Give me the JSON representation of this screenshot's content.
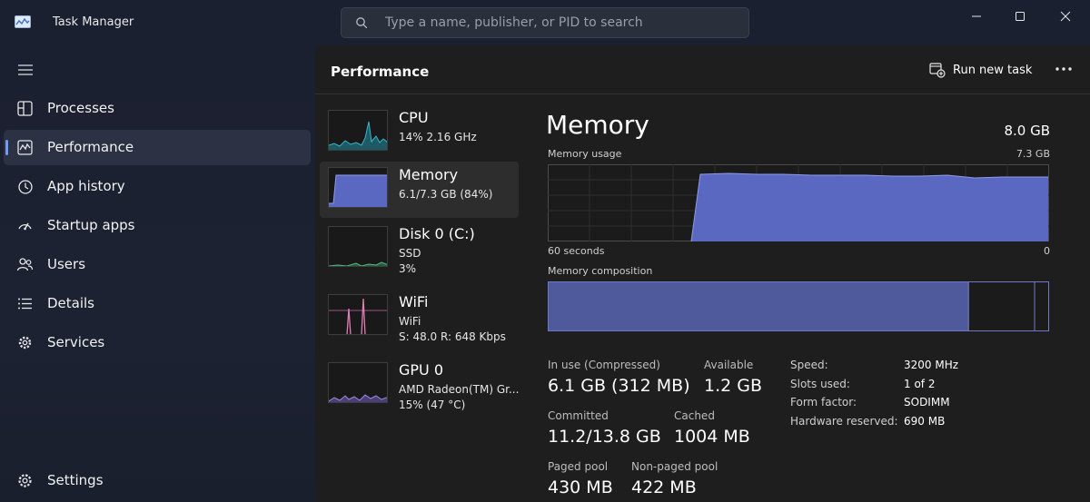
{
  "window": {
    "title": "Task Manager",
    "search_placeholder": "Type a name, publisher, or PID to search",
    "icons": [
      "minimize-icon",
      "maximize-icon",
      "close-icon"
    ]
  },
  "sidebar": {
    "items": [
      {
        "label": "Processes",
        "icon": "processes-icon"
      },
      {
        "label": "Performance",
        "icon": "performance-icon",
        "active": true
      },
      {
        "label": "App history",
        "icon": "history-icon"
      },
      {
        "label": "Startup apps",
        "icon": "startup-icon"
      },
      {
        "label": "Users",
        "icon": "users-icon"
      },
      {
        "label": "Details",
        "icon": "details-icon"
      },
      {
        "label": "Services",
        "icon": "services-icon"
      }
    ],
    "settings_label": "Settings"
  },
  "main": {
    "title": "Performance",
    "run_new_task_label": "Run new task"
  },
  "devices": [
    {
      "name": "CPU",
      "line1": "14%  2.16 GHz",
      "line2": ""
    },
    {
      "name": "Memory",
      "line1": "6.1/7.3 GB (84%)",
      "line2": ""
    },
    {
      "name": "Disk 0 (C:)",
      "line1": "SSD",
      "line2": "3%"
    },
    {
      "name": "WiFi",
      "line1": "WiFi",
      "line2": "S: 48.0  R: 648 Kbps"
    },
    {
      "name": "GPU 0",
      "line1": "AMD Radeon(TM) Gr...",
      "line2": "15%  (47 °C)"
    }
  ],
  "memory": {
    "title": "Memory",
    "total": "8.0 GB",
    "usage_label": "Memory usage",
    "usage_max": "7.3 GB",
    "axis_left": "60 seconds",
    "axis_right": "0",
    "composition_label": "Memory composition",
    "stats": {
      "in_use_label": "In use (Compressed)",
      "in_use_value": "6.1 GB (312 MB)",
      "available_label": "Available",
      "available_value": "1.2 GB",
      "committed_label": "Committed",
      "committed_value": "11.2/13.8 GB",
      "cached_label": "Cached",
      "cached_value": "1004 MB",
      "paged_label": "Paged pool",
      "paged_value": "430 MB",
      "nonpaged_label": "Non-paged pool",
      "nonpaged_value": "422 MB"
    },
    "specs": {
      "speed_label": "Speed:",
      "speed_value": "3200 MHz",
      "slots_label": "Slots used:",
      "slots_value": "1 of 2",
      "form_label": "Form factor:",
      "form_value": "SODIMM",
      "reserved_label": "Hardware reserved:",
      "reserved_value": "690 MB"
    }
  },
  "colors": {
    "memory_fill": "#5b68c2",
    "memory_line": "#8f9ae8",
    "cpu_line": "#3bb4c8",
    "wifi_line": "#e07fb6",
    "gpu_line": "#9b8ad8",
    "accent": "#6f9cf0"
  }
}
